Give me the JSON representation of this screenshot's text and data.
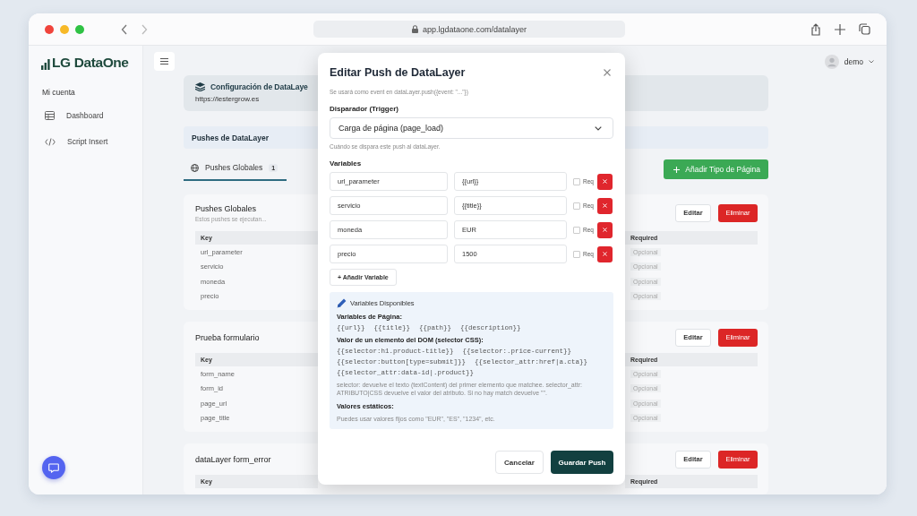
{
  "browser": {
    "url": "app.lgdataone.com/datalayer"
  },
  "sidebar": {
    "logo": "LG DataOne",
    "section": "Mi cuenta",
    "items": [
      {
        "label": "Dashboard",
        "kind": "table"
      },
      {
        "label": "Script Insert",
        "kind": "code"
      }
    ]
  },
  "user": {
    "name": "demo"
  },
  "header": {
    "title": "Configuración de DataLaye",
    "url": "https://lestergrow.es"
  },
  "section_title": "Pushes de DataLayer",
  "tabs": [
    {
      "label": "Pushes Globales",
      "count": "1",
      "selected": true
    }
  ],
  "add_button": "Añadir Tipo de Página",
  "cards": [
    {
      "title": "Pushes Globales",
      "description": "Estos pushes se ejecutan...",
      "columns": [
        "Key",
        "Required"
      ],
      "edit": "Editar",
      "delete": "Eliminar",
      "rows": [
        {
          "key": "url_parameter",
          "required": "Opcional"
        },
        {
          "key": "servicio",
          "required": "Opcional"
        },
        {
          "key": "moneda",
          "required": "Opcional"
        },
        {
          "key": "precio",
          "required": "Opcional"
        }
      ]
    },
    {
      "title": "Prueba formulario",
      "columns": [
        "Key",
        "Required"
      ],
      "edit": "Editar",
      "delete": "Eliminar",
      "rows": [
        {
          "key": "form_name",
          "required": "Opcional"
        },
        {
          "key": "form_id",
          "required": "Opcional"
        },
        {
          "key": "page_url",
          "required": "Opcional"
        },
        {
          "key": "page_title",
          "required": "Opcional"
        }
      ]
    },
    {
      "title": "dataLayer form_error",
      "columns": [
        "Key",
        "Required"
      ],
      "edit": "Editar",
      "delete": "Eliminar"
    }
  ],
  "modal": {
    "title": "Editar Push de DataLayer",
    "hint": "Se usará como event en dataLayer.push({event: \"...\"})",
    "trigger_label": "Disparador (Trigger)",
    "trigger_value": "Carga de página (page_load)",
    "trigger_hint": "Cuándo se dispara este push al dataLayer.",
    "variables_label": "Variables",
    "variables": [
      {
        "name": "url_parameter",
        "value": "{{url}}",
        "req_label": "Req",
        "required": false
      },
      {
        "name": "servicio",
        "value": "{{title}}",
        "req_label": "Req",
        "required": false
      },
      {
        "name": "moneda",
        "value": "EUR",
        "req_label": "Req",
        "required": false
      },
      {
        "name": "precio",
        "value": "1500",
        "req_label": "Req",
        "required": false
      }
    ],
    "add_variable": "+ Añadir Variable",
    "info": {
      "title": "Variables Disponibles",
      "page_heading": "Variables de Página:",
      "page_vars": [
        "{{url}}",
        "{{title}}",
        "{{path}}",
        "{{description}}"
      ],
      "dom_heading": "Valor de un elemento del DOM (selector CSS):",
      "dom_vars": [
        "{{selector:h1.product-title}}",
        "{{selector:.price-current}}",
        "{{selector:button[type=submit]}}",
        "{{selector_attr:href|a.cta}}",
        "{{selector_attr:data-id|.product}}"
      ],
      "dom_note": "selector: devuelve el texto (textContent) del primer elemento que matchee. selector_attr: ATRIBUTO|CSS devuelve el valor del atributo. Si no hay match devuelve \"\".",
      "static_heading": "Valores estáticos:",
      "static_note": "Puedes usar valores fijos como \"EUR\", \"ES\", \"1234\", etc."
    },
    "cancel": "Cancelar",
    "save": "Guardar Push"
  }
}
